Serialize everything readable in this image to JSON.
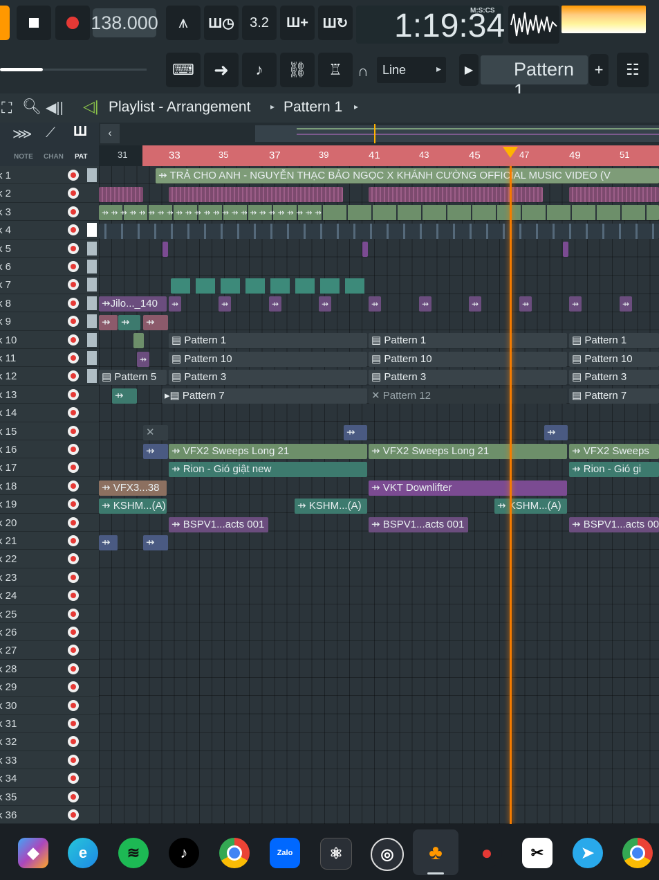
{
  "toolbar": {
    "tempo": "138.000",
    "time": "1:19:34",
    "time_label": "M:S:CS",
    "snap": "Line",
    "pattern": "Pattern 1"
  },
  "title": {
    "playlist": "Playlist - Arrangement",
    "pattern": "Pattern 1"
  },
  "left_tabs": [
    "NOTE",
    "CHAN",
    "PAT"
  ],
  "ruler": [
    "31",
    "33",
    "35",
    "37",
    "39",
    "41",
    "43",
    "45",
    "47",
    "49",
    "51"
  ],
  "tracks": [
    "k 1",
    "k 2",
    "k 3",
    "k 4",
    "k 5",
    "k 6",
    "k 7",
    "k 8",
    "k 9",
    "k 10",
    "k 11",
    "k 12",
    "k 13",
    "k 14",
    "k 15",
    "k 16",
    "k 17",
    "k 18",
    "k 19",
    "k 20",
    "k 21",
    "k 22",
    "k 23",
    "k 24",
    "k 25",
    "k 26",
    "k 27",
    "k 28",
    "k 29",
    "k 30",
    "k 31",
    "k 32",
    "k 33",
    "k 34",
    "k 35",
    "k 36"
  ],
  "clips": {
    "song": "TRẢ CHO ANH - NGUYỄN THẠC BẢO NGỌC X KHÁNH CƯỜNG  OFFICIAL MUSIC VIDEO (V",
    "jilo": "Jilo..._140",
    "p5": "Pattern 5",
    "p1": "Pattern 1",
    "p10": "Pattern 10",
    "p3": "Pattern 3",
    "p7": "Pattern 7",
    "p12": "Pattern 12",
    "vfx2": "VFX2 Sweeps Long 21",
    "vfx2b": "VFX2 Sweeps",
    "rion": "Rion - Gió giật new",
    "rionb": "Rion - Gió gi",
    "vfx3": "VFX3...38",
    "vkt": "VKT Downlifter",
    "kshm": "KSHM...(A)",
    "bspv": "BSPV1...acts 001",
    "bspvb": "BSPV1...acts 00"
  },
  "colors": {
    "green": "#6d8f6a",
    "purple": "#6b4d7e",
    "teal": "#3d7a6e",
    "dark": "#394349",
    "playhead": "#f57c00"
  }
}
